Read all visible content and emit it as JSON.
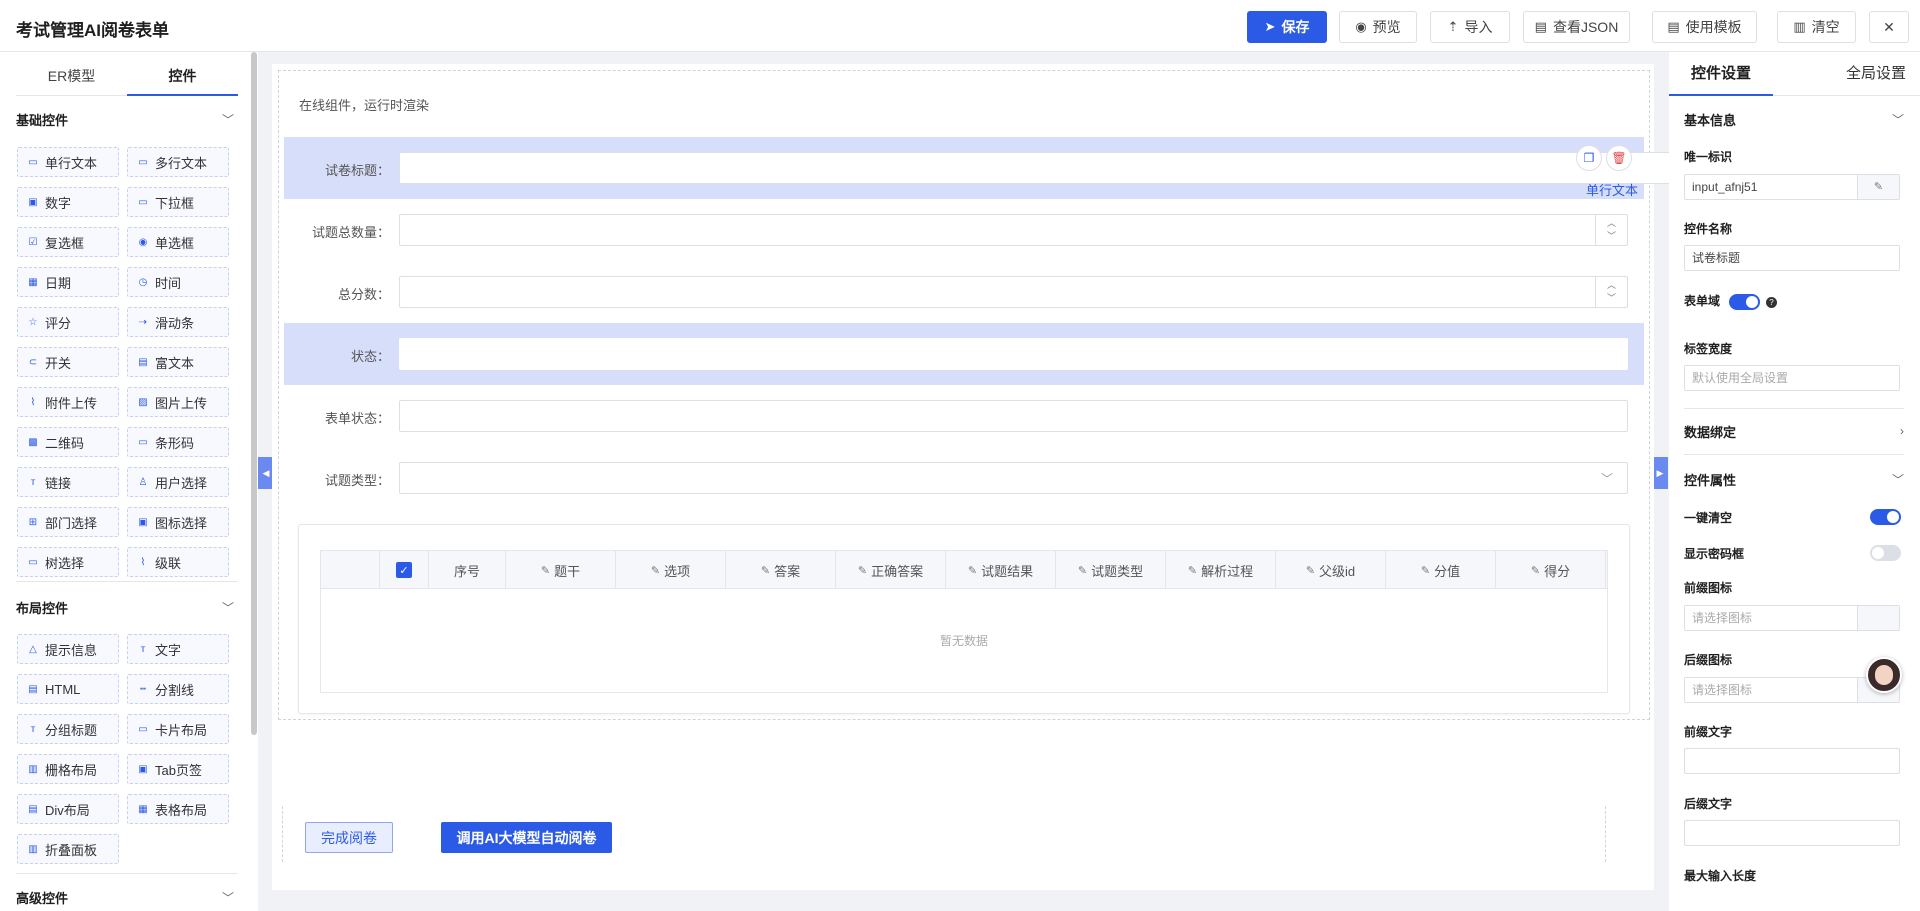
{
  "app": {
    "title": "考试管理AI阅卷表单"
  },
  "toolbar": {
    "save": "保存",
    "preview": "预览",
    "import": "导入",
    "view_json": "查看JSON",
    "use_template": "使用模板",
    "clear": "清空",
    "close": "✕"
  },
  "left_panel": {
    "tabs": [
      "ER模型",
      "控件"
    ],
    "active_tab": "控件",
    "basic_group": {
      "title": "基础控件",
      "items": [
        {
          "label": "单行文本",
          "icon": "input-icon"
        },
        {
          "label": "多行文本",
          "icon": "textarea-icon"
        },
        {
          "label": "数字",
          "icon": "number-icon"
        },
        {
          "label": "下拉框",
          "icon": "select-icon"
        },
        {
          "label": "复选框",
          "icon": "checkbox-icon"
        },
        {
          "label": "单选框",
          "icon": "radio-icon"
        },
        {
          "label": "日期",
          "icon": "date-icon"
        },
        {
          "label": "时间",
          "icon": "time-icon"
        },
        {
          "label": "评分",
          "icon": "star-icon"
        },
        {
          "label": "滑动条",
          "icon": "slider-icon"
        },
        {
          "label": "开关",
          "icon": "switch-icon"
        },
        {
          "label": "富文本",
          "icon": "richtext-icon"
        },
        {
          "label": "附件上传",
          "icon": "attachment-icon"
        },
        {
          "label": "图片上传",
          "icon": "image-icon"
        },
        {
          "label": "二维码",
          "icon": "qrcode-icon"
        },
        {
          "label": "条形码",
          "icon": "barcode-icon"
        },
        {
          "label": "链接",
          "icon": "link-icon"
        },
        {
          "label": "用户选择",
          "icon": "user-icon"
        },
        {
          "label": "部门选择",
          "icon": "org-icon"
        },
        {
          "label": "图标选择",
          "icon": "icon-picker-icon"
        },
        {
          "label": "树选择",
          "icon": "tree-icon"
        },
        {
          "label": "级联",
          "icon": "cascade-icon"
        }
      ]
    },
    "layout_group": {
      "title": "布局控件",
      "items": [
        {
          "label": "提示信息",
          "icon": "alert-icon"
        },
        {
          "label": "文字",
          "icon": "text-icon"
        },
        {
          "label": "HTML",
          "icon": "html-icon"
        },
        {
          "label": "分割线",
          "icon": "divider-icon"
        },
        {
          "label": "分组标题",
          "icon": "group-title-icon"
        },
        {
          "label": "卡片布局",
          "icon": "card-icon"
        },
        {
          "label": "栅格布局",
          "icon": "grid-icon"
        },
        {
          "label": "Tab页签",
          "icon": "tab-icon"
        },
        {
          "label": "Div布局",
          "icon": "div-icon"
        },
        {
          "label": "表格布局",
          "icon": "table-icon"
        },
        {
          "label": "折叠面板",
          "icon": "collapse-icon"
        }
      ]
    },
    "advanced_group": {
      "title": "高级控件"
    }
  },
  "canvas": {
    "note": "在线组件，运行时渲染",
    "fields": [
      {
        "label": "试卷标题：",
        "type": "text",
        "selected": true,
        "badge": "单行文本"
      },
      {
        "label": "试题总数量：",
        "type": "number"
      },
      {
        "label": "总分数：",
        "type": "number"
      },
      {
        "label": "状态：",
        "type": "text",
        "highlighted": true
      },
      {
        "label": "表单状态：",
        "type": "text"
      },
      {
        "label": "试题类型：",
        "type": "select"
      }
    ],
    "table": {
      "columns": [
        "序号",
        "题干",
        "选项",
        "答案",
        "正确答案",
        "试题结果",
        "试题类型",
        "解析过程",
        "父级id",
        "分值",
        "得分"
      ],
      "empty_text": "暂无数据"
    },
    "buttons": {
      "finish": "完成阅卷",
      "ai": "调用AI大模型自动阅卷"
    }
  },
  "right_panel": {
    "tabs": [
      "控件设置",
      "全局设置"
    ],
    "active_tab": "控件设置",
    "basic_info": {
      "title": "基本信息",
      "unique_id_label": "唯一标识",
      "unique_id_value": "input_afnj51",
      "name_label": "控件名称",
      "name_value": "试卷标题",
      "form_field_label": "表单域",
      "form_field_on": true,
      "label_width_label": "标签宽度",
      "label_width_placeholder": "默认使用全局设置"
    },
    "data_binding": {
      "title": "数据绑定"
    },
    "props": {
      "title": "控件属性",
      "clearable_label": "一键清空",
      "clearable_on": true,
      "show_password_label": "显示密码框",
      "show_password_on": false,
      "prefix_icon_label": "前缀图标",
      "prefix_icon_placeholder": "请选择图标",
      "suffix_icon_label": "后缀图标",
      "suffix_icon_placeholder": "请选择图标",
      "prefix_text_label": "前缀文字",
      "suffix_text_label": "后缀文字",
      "max_length_label": "最大输入长度"
    }
  },
  "colors": {
    "primary": "#2b5ae6",
    "selected_row": "#d7defa"
  }
}
